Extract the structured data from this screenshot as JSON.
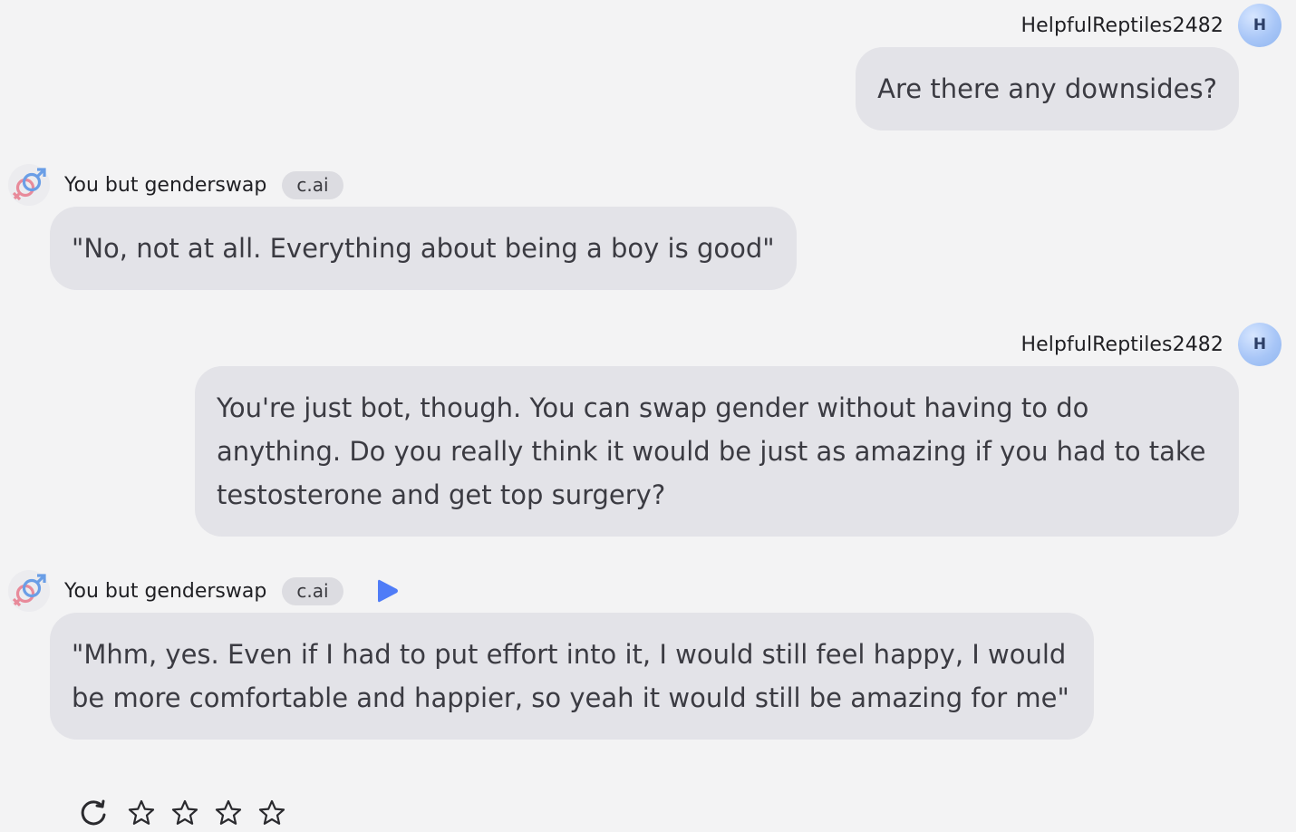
{
  "messages": [
    {
      "role": "user",
      "author": "HelpfulReptiles2482",
      "avatar_letter": "H",
      "text": "Are there any downsides?"
    },
    {
      "role": "bot",
      "author": "You but genderswap",
      "tag": "c.ai",
      "avatar_icon": "gender-symbol-icon",
      "text": "\"No, not at all. Everything about being a boy is good\""
    },
    {
      "role": "user",
      "author": "HelpfulReptiles2482",
      "avatar_letter": "H",
      "text": "You're just bot, though. You can swap gender without having to do anything. Do you really think it would be just as amazing if you had to take testosterone and get top surgery?"
    },
    {
      "role": "bot",
      "author": "You but genderswap",
      "tag": "c.ai",
      "avatar_icon": "gender-symbol-icon",
      "has_play_button": true,
      "text": "\"Mhm, yes. Even if I had to put effort into it, I would still feel happy, I would be more comfortable and happier, so yeah it would still be amazing for me\""
    }
  ],
  "actions": {
    "regenerate_icon": "refresh-icon",
    "rating_stars": 4,
    "rating_value": 0
  },
  "colors": {
    "background": "#f3f3f4",
    "bubble": "#e3e3e8",
    "tag_bg": "#dcdce1",
    "play_accent": "#4f7cf7",
    "user_avatar": "#a8c6f7"
  }
}
